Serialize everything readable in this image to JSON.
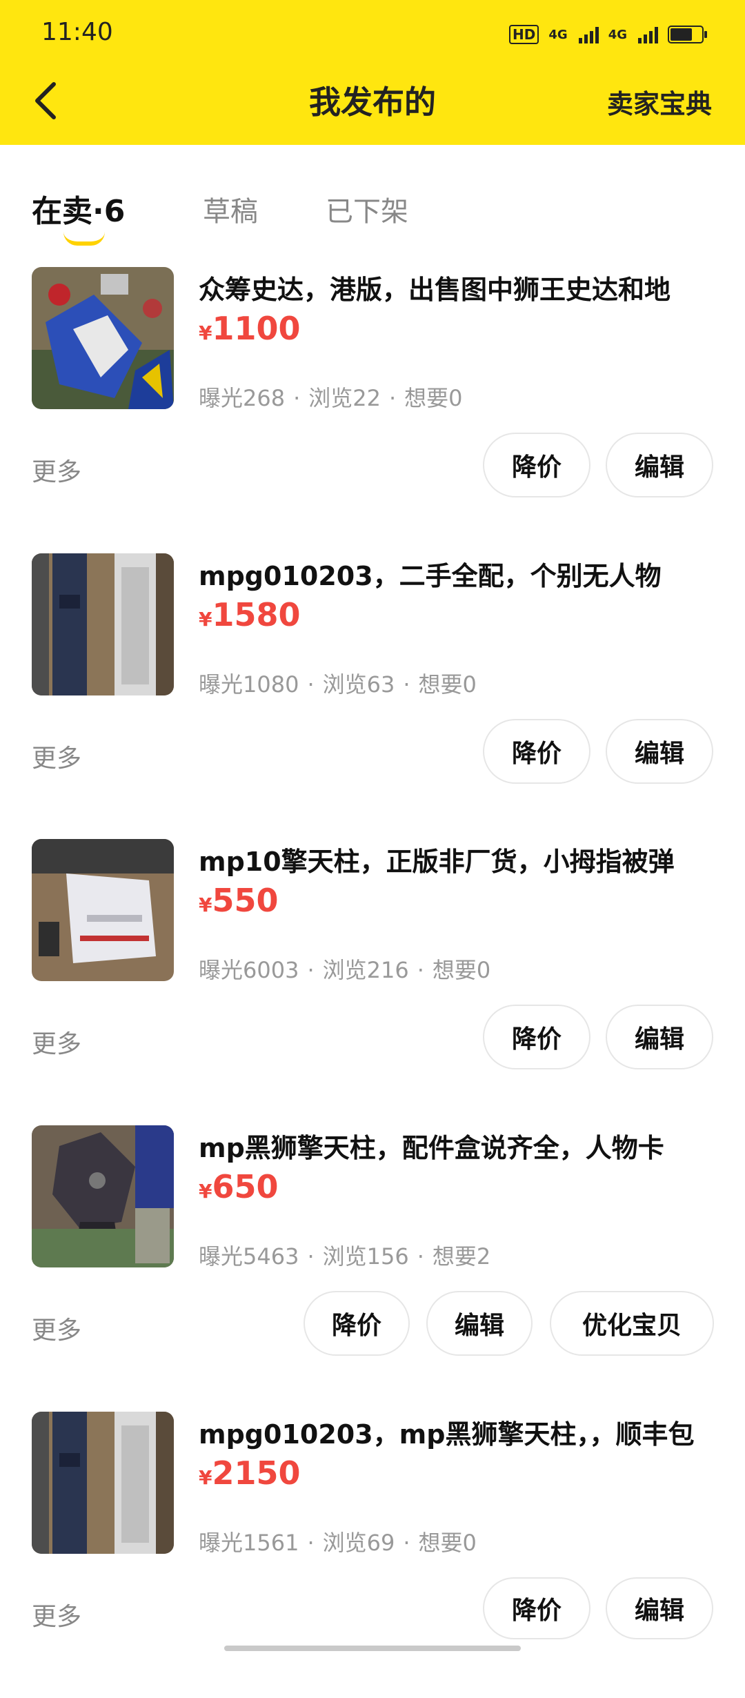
{
  "status_bar": {
    "time": "11:40",
    "hd_badge": "HD",
    "network_1": "4G",
    "network_2": "4G",
    "battery_level": 0.7
  },
  "header": {
    "title": "我发布的",
    "guide_link": "卖家宝典"
  },
  "tabs": [
    {
      "label": "在卖·6",
      "active": true
    },
    {
      "label": "草稿",
      "active": false
    },
    {
      "label": "已下架",
      "active": false
    }
  ],
  "currency_symbol": "¥",
  "more_label": "更多",
  "items": [
    {
      "title": "众筹史达，港版，出售图中狮王史达和地",
      "price": "1100",
      "stats": {
        "exposure": "曝光268",
        "views": "浏览22",
        "wants": "想要0"
      },
      "buttons": [
        "降价",
        "编辑"
      ]
    },
    {
      "title": "mpg010203，二手全配，个别无人物",
      "price": "1580",
      "stats": {
        "exposure": "曝光1080",
        "views": "浏览63",
        "wants": "想要0"
      },
      "buttons": [
        "降价",
        "编辑"
      ]
    },
    {
      "title": "mp10擎天柱，正版非厂货，小拇指被弹",
      "price": "550",
      "stats": {
        "exposure": "曝光6003",
        "views": "浏览216",
        "wants": "想要0"
      },
      "buttons": [
        "降价",
        "编辑"
      ]
    },
    {
      "title": "mp黑狮擎天柱，配件盒说齐全，人物卡",
      "price": "650",
      "stats": {
        "exposure": "曝光5463",
        "views": "浏览156",
        "wants": "想要2"
      },
      "buttons": [
        "降价",
        "编辑",
        "优化宝贝"
      ]
    },
    {
      "title": "mpg010203，mp黑狮擎天柱，，顺丰包",
      "price": "2150",
      "stats": {
        "exposure": "曝光1561",
        "views": "浏览69",
        "wants": "想要0"
      },
      "buttons": [
        "降价",
        "编辑"
      ]
    }
  ]
}
